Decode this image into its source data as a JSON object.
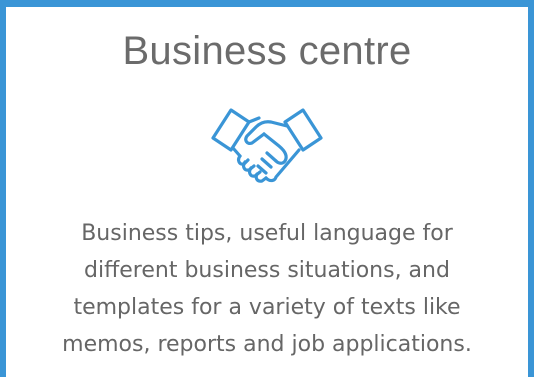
{
  "card": {
    "title": "Business centre",
    "icon": "handshake-icon",
    "description": "Business tips, useful language for different business situations, and templates for a variety of texts like memos, reports and job applications."
  },
  "colors": {
    "border": "#3a95d6",
    "icon": "#3a95d6",
    "title": "#6b6b6b",
    "text": "#666666",
    "background": "#ffffff"
  }
}
